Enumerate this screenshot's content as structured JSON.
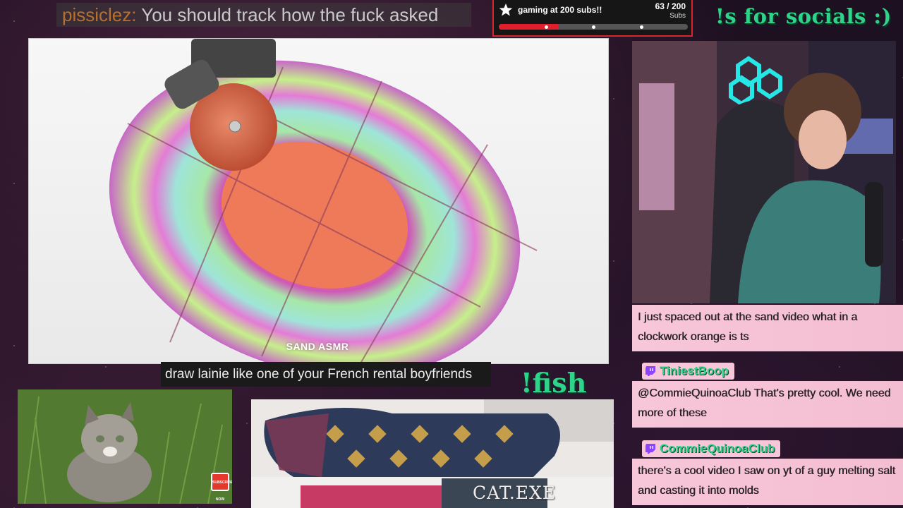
{
  "top_message": {
    "username": "pissiclez",
    "separator": ":",
    "text": "You should track how the fuck asked"
  },
  "sub_goal": {
    "title": "gaming at 200 subs!!",
    "count": "63 / 200",
    "unit": "Subs",
    "progress_fraction": 0.315,
    "accent_color": "#e11e2b",
    "icon": "star-icon"
  },
  "socials_text": "!s for socials :)",
  "main_video": {
    "brand": "SAND ASMR"
  },
  "caption": "draw lainie like one of your French rental boyfriends",
  "fish_command": "!fish",
  "cat_video": {
    "badge": "SUBSCRIBE NOW"
  },
  "bed_cam": {
    "label": "CAT.EXE"
  },
  "chat": {
    "messages": [
      {
        "name": "",
        "text": "I just spaced out at the sand video what in a clockwork orange is ts"
      },
      {
        "name": "TiniestBoop",
        "text": "@CommieQuinoaClub That's pretty cool. We need more of these"
      },
      {
        "name": "CommieQuinoaClub",
        "text": "there's a cool video I saw on yt of a guy melting salt and casting it into molds"
      }
    ],
    "name_color": "#2fd48b",
    "bubble_color": "#f7c6d8",
    "platform_icon": "twitch-icon"
  }
}
